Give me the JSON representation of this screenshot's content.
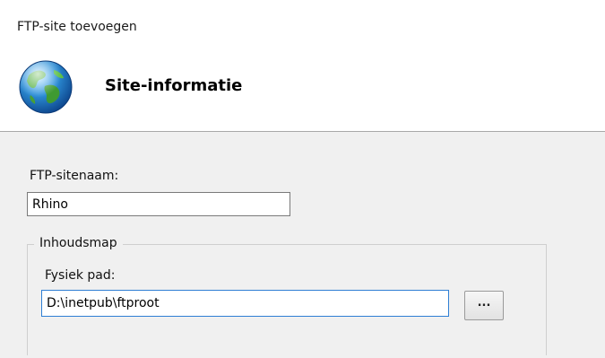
{
  "window": {
    "title": "FTP-site toevoegen",
    "heading": "Site-informatie",
    "icon": "globe-icon"
  },
  "site_name": {
    "label": "FTP-sitenaam:",
    "value": "Rhino"
  },
  "content_folder": {
    "group_title": "Inhoudsmap",
    "path_label": "Fysiek pad:",
    "path_value": "D:\\inetpub\\ftproot",
    "browse_label": "..."
  },
  "colors": {
    "header_bg": "#ffffff",
    "body_bg": "#f0f0f0",
    "focus_border": "#2f7fd4"
  }
}
